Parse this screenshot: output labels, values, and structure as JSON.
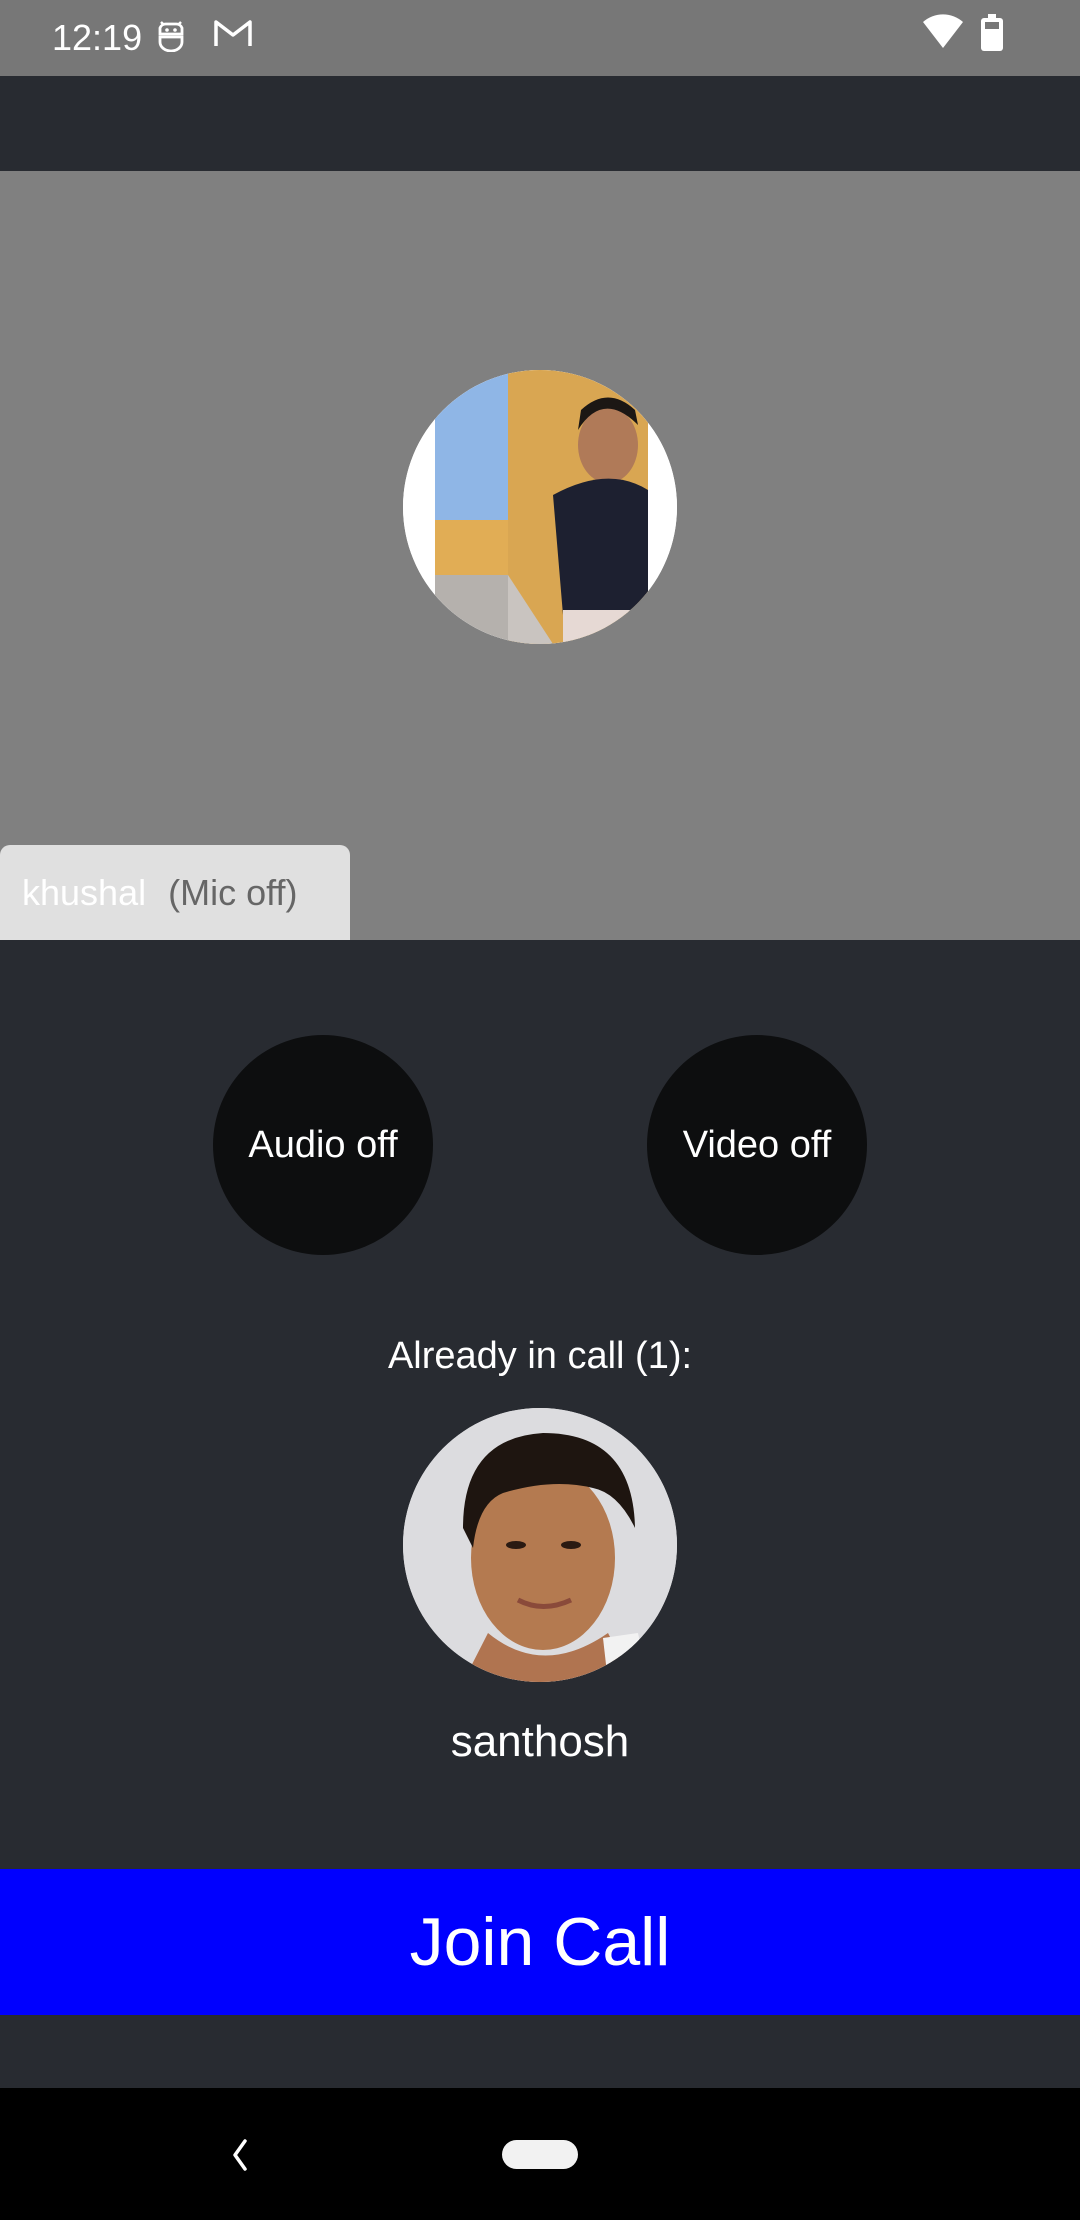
{
  "status_bar": {
    "time": "12:19",
    "left_icons": [
      "debug-bot-icon",
      "gmail-icon"
    ],
    "right_icons": [
      "wifi-icon",
      "battery-icon"
    ]
  },
  "preview": {
    "self_avatar": "profile-photo-khushal",
    "participant_name": "khushal",
    "mic_status": "(Mic off)"
  },
  "controls": {
    "audio_label": "Audio off",
    "video_label": "Video off"
  },
  "in_call": {
    "label": "Already in call (1):",
    "participants": [
      {
        "name": "santhosh",
        "avatar": "profile-photo-santhosh"
      }
    ]
  },
  "join_button": {
    "label": "Join Call",
    "color": "#0000ff"
  },
  "nav": {
    "icons": [
      "back-icon",
      "home-pill-icon"
    ]
  },
  "colors": {
    "background": "#282b31",
    "preview_bg": "#808080",
    "status_bar_bg": "#777777",
    "control_bg": "#0d0e0f",
    "pill_bg": "#e0e0e0"
  }
}
